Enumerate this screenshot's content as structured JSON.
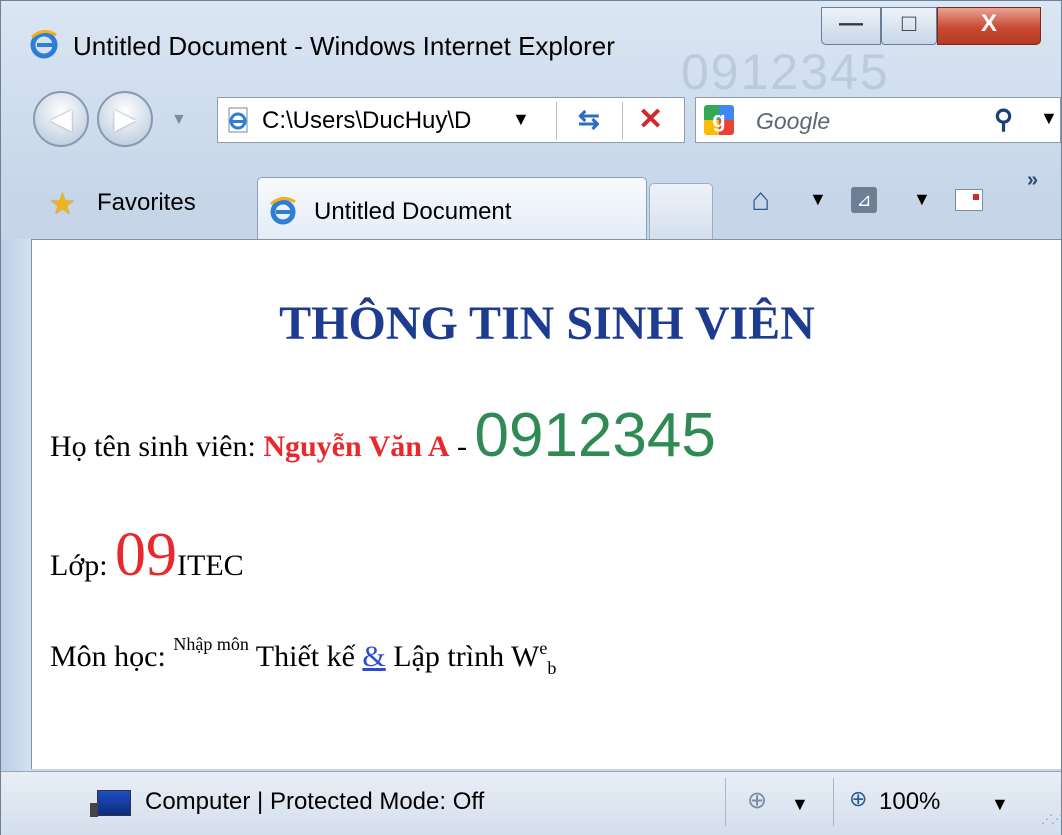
{
  "window": {
    "title": "Untitled Document - Windows Internet Explorer",
    "ghost_text": "0912345",
    "controls": {
      "minimize": "—",
      "maximize": "□",
      "close": "X"
    }
  },
  "nav": {
    "address": "C:\\Users\\DucHuy\\D",
    "search_placeholder": "Google",
    "google_letter": "g"
  },
  "tabs": {
    "favorites_label": "Favorites",
    "active_tab_label": "Untitled Document",
    "chevron": "»"
  },
  "page": {
    "heading": "THÔNG TIN SINH VIÊN",
    "name_label": "Họ tên sinh viên: ",
    "name_value": "Nguyễn Văn A",
    "dash": " - ",
    "student_id": "0912345",
    "class_label": "Lớp: ",
    "class_number": "09",
    "class_code": "ITEC",
    "subject_label": "Môn học: ",
    "subject_sup": "Nhập môn",
    "subject_mid": " Thiết kế ",
    "subject_amp": "&",
    "subject_end": " Lập trình W",
    "subject_sup_e": "e",
    "subject_sub_b": "b"
  },
  "status": {
    "zone_text": "Computer | Protected Mode: Off",
    "zoom": "100%"
  },
  "colors": {
    "heading": "#1d3c8f",
    "name": "#e8282d",
    "student_id": "#2f8a54",
    "link": "#2a4bd8"
  }
}
